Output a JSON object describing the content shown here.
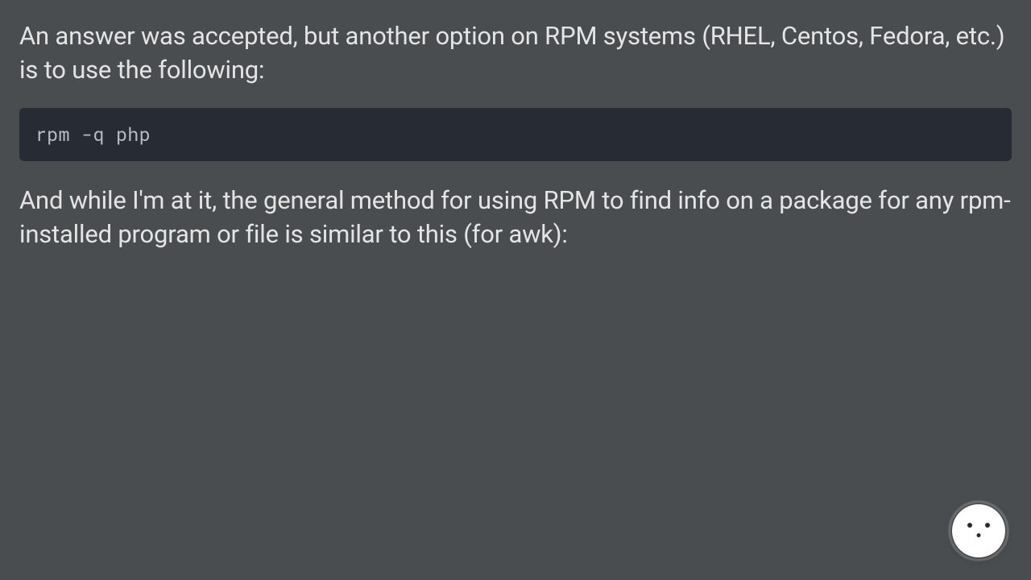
{
  "answer": {
    "paragraph1": "An answer was accepted, but another option on RPM systems (RHEL, Centos, Fedora, etc.) is to use the following:",
    "code1": "rpm -q php",
    "paragraph2": "And while I'm at it, the general method for using RPM to find info on a package for any rpm-installed program or file is similar to this (for awk):"
  }
}
